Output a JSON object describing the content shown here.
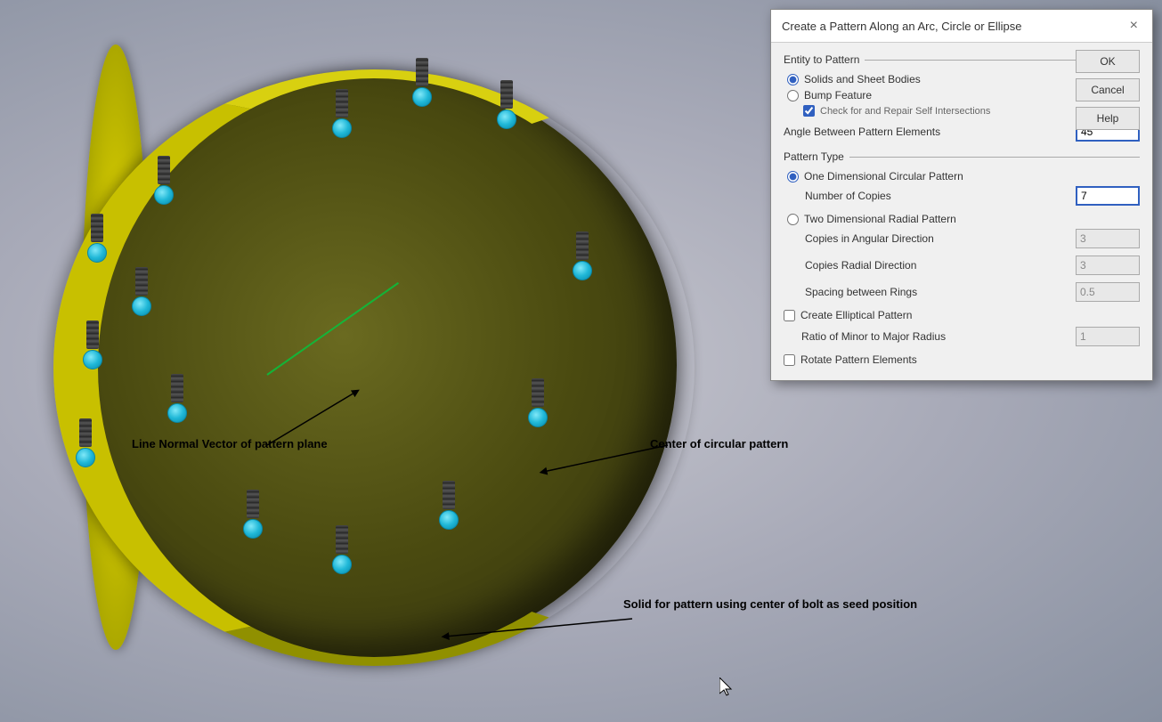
{
  "dialog": {
    "title": "Create a Pattern Along an Arc, Circle or Ellipse",
    "close_button": "×",
    "buttons": {
      "ok": "OK",
      "cancel": "Cancel",
      "help": "Help"
    },
    "entity_section": "Entity to Pattern",
    "entity_options": [
      {
        "id": "solids",
        "label": "Solids and Sheet Bodies",
        "checked": true
      },
      {
        "id": "bump",
        "label": "Bump Feature",
        "checked": false
      }
    ],
    "check_intersections": {
      "label": "Check for and Repair Self Intersections",
      "checked": true
    },
    "angle_label": "Angle Between Pattern Elements",
    "angle_value": "45",
    "pattern_section": "Pattern Type",
    "pattern_options": [
      {
        "id": "one_dim",
        "label": "One Dimensional Circular Pattern",
        "checked": true
      },
      {
        "id": "two_dim",
        "label": "Two Dimensional Radial Pattern",
        "checked": false
      }
    ],
    "number_of_copies_label": "Number of Copies",
    "number_of_copies_value": "7",
    "copies_angular_label": "Copies in Angular Direction",
    "copies_angular_value": "3",
    "copies_radial_label": "Copies Radial Direction",
    "copies_radial_value": "3",
    "spacing_rings_label": "Spacing between Rings",
    "spacing_rings_value": "0.5",
    "elliptical_label": "Create Elliptical Pattern",
    "elliptical_checked": false,
    "ratio_label": "Ratio of Minor to Major Radius",
    "ratio_value": "1",
    "rotate_label": "Rotate Pattern Elements",
    "rotate_checked": false
  },
  "annotations": {
    "line_normal": "Line Normal Vector of pattern\nplane",
    "center_circular": "Center of circular\npattern",
    "solid_pattern": "Solid for pattern using center\nof bolt as seed position"
  },
  "viewport": {
    "background_start": "#c8c8d0",
    "background_end": "#8890a0"
  }
}
